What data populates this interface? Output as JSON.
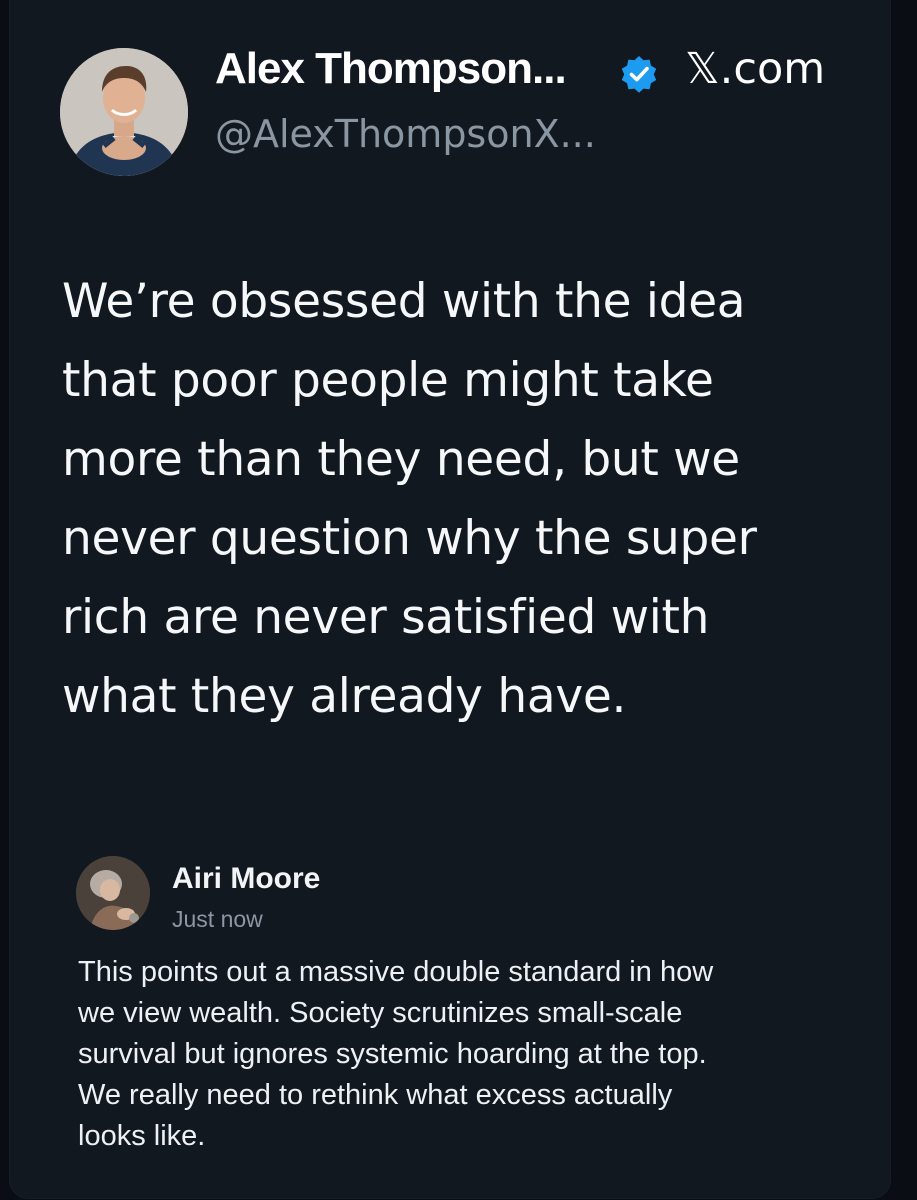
{
  "post": {
    "author_name": "Alex Thompson...",
    "author_handle": "@AlexThompsonX...",
    "source_label": ".com",
    "source_mark": "𝕏",
    "verified_icon": "verified-badge-icon",
    "verified_color": "#1d9bf0",
    "body_lines": [
      "We’re obsessed with the idea",
      "that poor people might take",
      "more than they need, but we",
      "never question why the super",
      "rich are never satisfied with",
      "what they already have."
    ]
  },
  "reply": {
    "author_name": "Airi Moore",
    "timestamp": "Just now",
    "body_lines": [
      "This points out a massive double standard in how",
      "we view wealth. Society scrutinizes small-scale",
      "survival but ignores systemic hoarding at the top.",
      "We really need to rethink what excess actually",
      "looks like."
    ]
  },
  "colors": {
    "background": "#0a0d13",
    "card": "#121820",
    "text_primary": "#ffffff",
    "text_secondary": "#8b96a3"
  }
}
